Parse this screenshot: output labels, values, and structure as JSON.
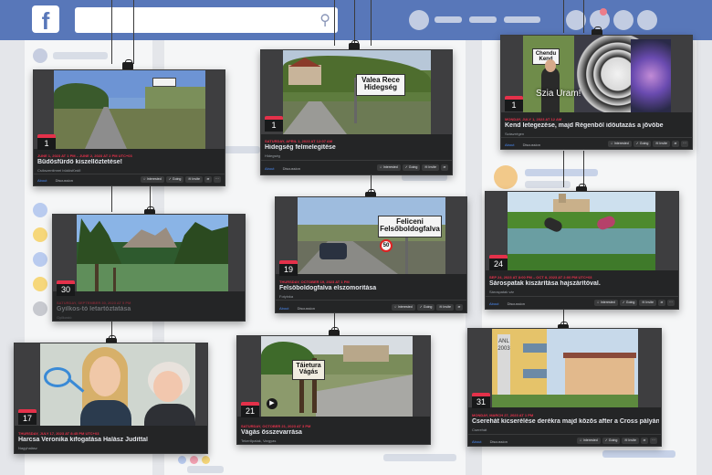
{
  "facebook": {
    "logo": "f",
    "search_icon": "search-icon"
  },
  "cards": [
    {
      "day": "1",
      "date": "JUNE 1, 2023 AT 1 PM – JUNE 2, 2023 AT 2 PM UTC+03",
      "title": "Büdösfürdő kiszellőztetése!",
      "location": "Csíkszentimrei büdösfürdő",
      "tab_about": "About",
      "tab_discussion": "Discussion",
      "btn_interested": "Interested",
      "btn_going": "Going",
      "btn_invite": "Invite"
    },
    {
      "day": "1",
      "date": "SATURDAY, APRIL 1, 2023 AT 12:07 AM",
      "title": "Hidegség felmelegítése",
      "location": "Hidegség",
      "tab_about": "About",
      "tab_discussion": "Discussion",
      "btn_interested": "Interested",
      "btn_going": "Going",
      "btn_invite": "Invite",
      "sign_text_1": "Valea Rece",
      "sign_text_2": "Hidegség"
    },
    {
      "day": "1",
      "date": "MONDAY, JULY 1, 2023 AT 12 AM",
      "title": "Kend letegezése, majd Régenből időutazás a jövőbe",
      "location": "Szászrégen",
      "tab_about": "About",
      "tab_discussion": "Discussion",
      "btn_interested": "Interested",
      "btn_going": "Going",
      "btn_invite": "Invite",
      "sign_text_1": "Chendu",
      "sign_text_2": "Kend",
      "caption": "Szia Uram!"
    },
    {
      "day": "30",
      "date": "SATURDAY, SEPTEMBER 30, 2023 AT 5 PM",
      "title": "Gyilkos-tó letartóztatása",
      "location": "Gyilkostó"
    },
    {
      "day": "19",
      "date": "THURSDAY, OCTOBER 19, 2023 AT 1 PM",
      "title": "Felsőboldogfalva elszomorítása",
      "location": "Fotyinka",
      "tab_about": "About",
      "tab_discussion": "Discussion",
      "btn_interested": "Interested",
      "btn_going": "Going",
      "btn_invite": "Invite",
      "sign_text_1": "Feliceni",
      "sign_text_2": "Felsőboldogfalva",
      "speed_sign": "50"
    },
    {
      "day": "24",
      "date": "SEP 24, 2023 AT 8:00 PM – OCT 8, 2023 AT 2:00 PM UTC+03",
      "title": "Sárospatak kiszárítása hajszárítóval.",
      "location": "Sárospatak vár",
      "tab_about": "About",
      "tab_discussion": "Discussion",
      "btn_interested": "Interested",
      "btn_going": "Going",
      "btn_invite": "Invite"
    },
    {
      "day": "17",
      "date": "THURSDAY, JULY 17, 2023 AT 8:45 PM UTC+03",
      "title": "Harcsa Veronika kifogatása Halász Judittal",
      "location": "Nagyhalász"
    },
    {
      "day": "21",
      "date": "SATURDAY, OCTOBER 21, 2023 AT 3 PM",
      "title": "Vágás összevarrása",
      "location": "Tekerőpatak, Vargyas",
      "sign_text_1": "Táietura",
      "sign_text_2": "Vágás"
    },
    {
      "day": "31",
      "date": "MONDAY, MARCH 27, 2023 AT 1 PM",
      "title": "Cserehát kicserélése derékra majd közös after a Cross pályán",
      "location": "Cserehát",
      "tab_about": "About",
      "tab_discussion": "Discussion",
      "btn_interested": "Interested",
      "btn_going": "Going",
      "btn_invite": "Invite",
      "building_text": "ANL 2003"
    }
  ]
}
